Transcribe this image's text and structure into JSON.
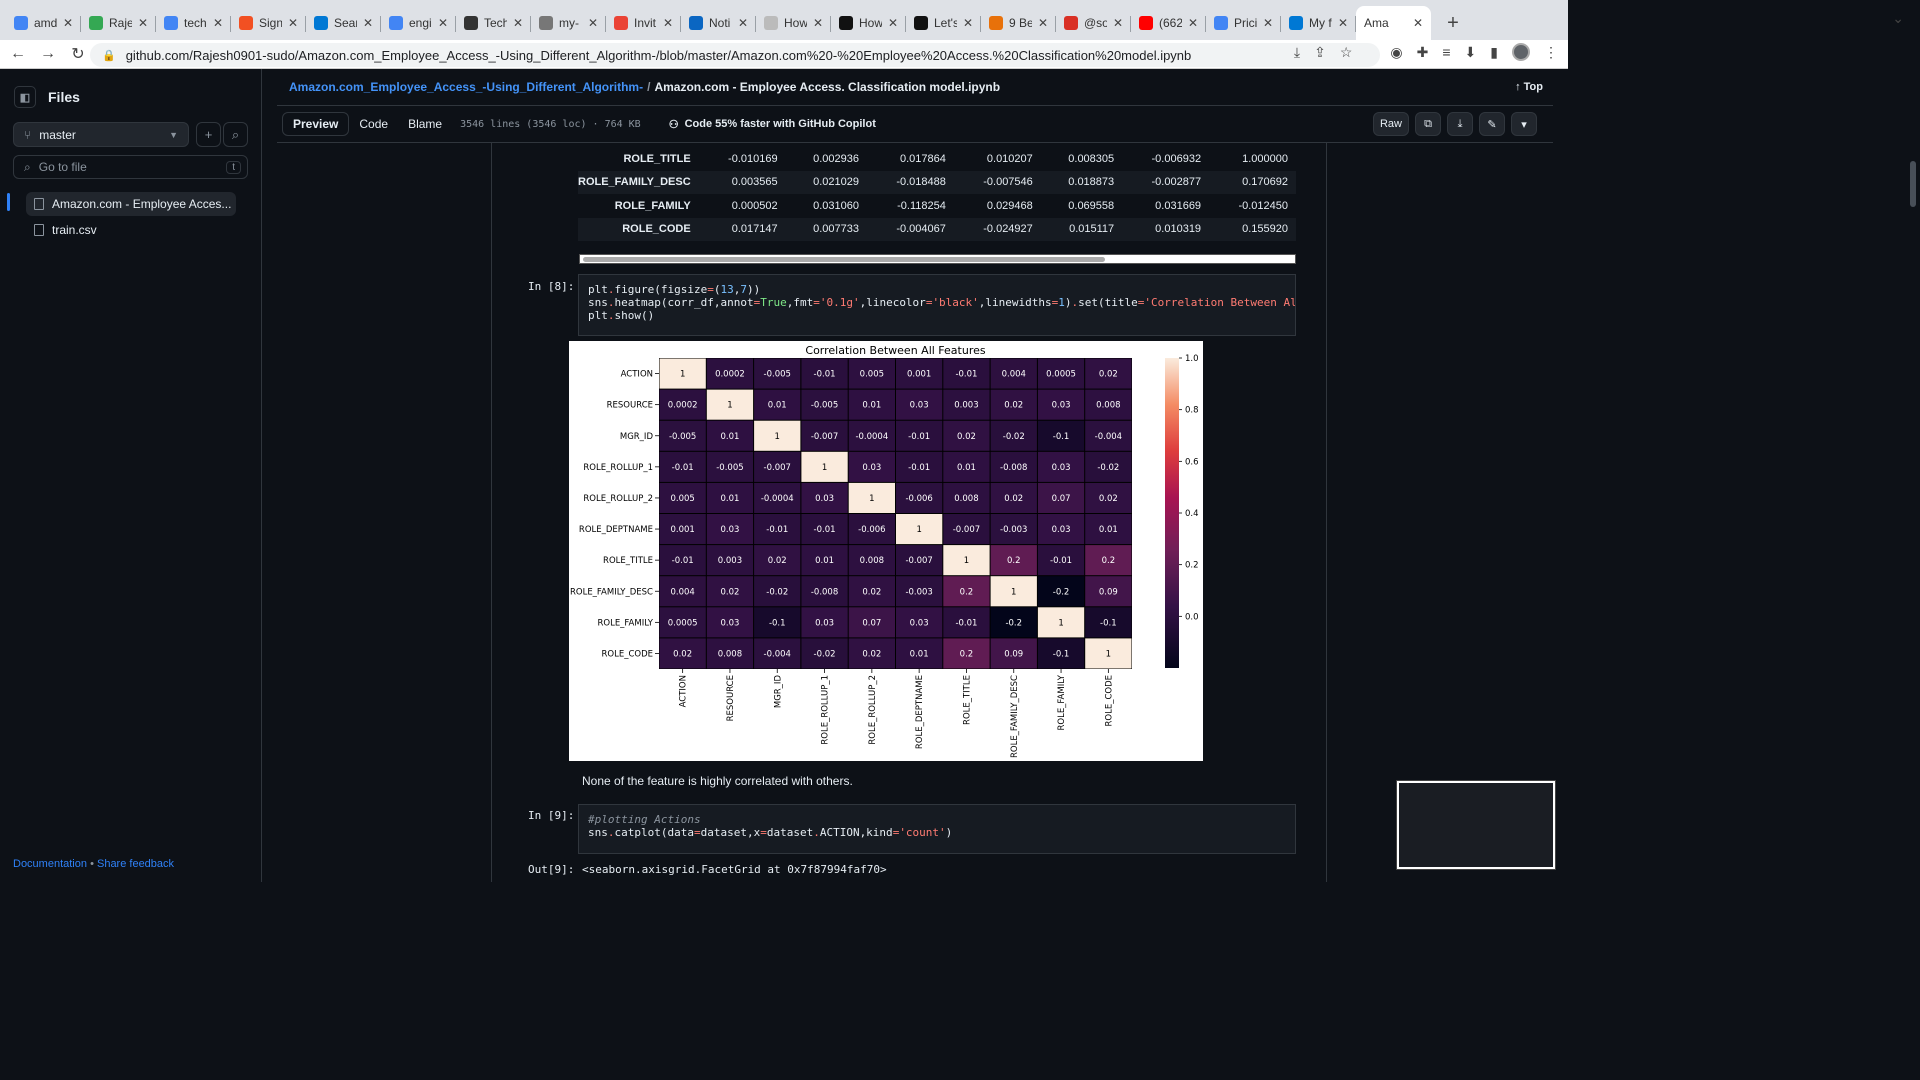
{
  "browser": {
    "tabs": [
      {
        "title": "amd",
        "icon": "google-icon",
        "color": "#4285f4"
      },
      {
        "title": "Raje",
        "icon": "link-icon",
        "color": "#34a853"
      },
      {
        "title": "tech",
        "icon": "google-icon",
        "color": "#4285f4"
      },
      {
        "title": "Sign",
        "icon": "microsoft-icon",
        "color": "#f25022"
      },
      {
        "title": "Sear",
        "icon": "cloud-icon",
        "color": "#0078d4"
      },
      {
        "title": "engi",
        "icon": "google-icon",
        "color": "#4285f4"
      },
      {
        "title": "Tech",
        "icon": "person-icon",
        "color": "#333"
      },
      {
        "title": "my-",
        "icon": "github-icon",
        "color": "#777"
      },
      {
        "title": "Invit",
        "icon": "gmail-icon",
        "color": "#ea4335"
      },
      {
        "title": "Noti",
        "icon": "linkedin-icon",
        "color": "#0a66c2"
      },
      {
        "title": "How",
        "icon": "page-icon",
        "color": "#bbb"
      },
      {
        "title": "How",
        "icon": "n-icon",
        "color": "#111"
      },
      {
        "title": "Let's",
        "icon": "medium-icon",
        "color": "#111"
      },
      {
        "title": "9 Be",
        "icon": "p-icon",
        "color": "#e8710a"
      },
      {
        "title": "@so",
        "icon": "t-icon",
        "color": "#d93025"
      },
      {
        "title": "(662",
        "icon": "youtube-icon",
        "color": "#ff0000"
      },
      {
        "title": "Prici",
        "icon": "gcloud-icon",
        "color": "#4285f4"
      },
      {
        "title": "My f",
        "icon": "cloud-icon",
        "color": "#0078d4"
      },
      {
        "title": "Ama",
        "icon": "none",
        "color": "#fff",
        "active": true
      }
    ],
    "url": "github.com/Rajesh0901-sudo/Amazon.com_Employee_Access_-Using_Different_Algorithm-/blob/master/Amazon.com%20-%20Employee%20Access.%20Classification%20model.ipynb"
  },
  "sidebar": {
    "title": "Files",
    "branch": "master",
    "goto_placeholder": "Go to file",
    "goto_kbd": "t",
    "files": [
      "Amazon.com - Employee Acces...",
      "train.csv"
    ],
    "footer": {
      "doc": "Documentation",
      "sep": "•",
      "feedback": "Share feedback"
    }
  },
  "header": {
    "repo": "Amazon.com_Employee_Access_-Using_Different_Algorithm-",
    "sep": "/",
    "file": "Amazon.com - Employee Access. Classification model.ipynb",
    "top": "Top",
    "tabs": {
      "preview": "Preview",
      "code": "Code",
      "blame": "Blame"
    },
    "info": "3546 lines (3546 loc) · 764 KB",
    "copilot": "Code 55% faster with GitHub Copilot",
    "raw": "Raw"
  },
  "table": {
    "rows": [
      {
        "label": "ROLE_TITLE",
        "cells": [
          "-0.010169",
          "0.002936",
          "0.017864",
          "0.010207",
          "0.008305",
          "-0.006932",
          "1.000000"
        ]
      },
      {
        "label": "ROLE_FAMILY_DESC",
        "cells": [
          "0.003565",
          "0.021029",
          "-0.018488",
          "-0.007546",
          "0.018873",
          "-0.002877",
          "0.170692"
        ]
      },
      {
        "label": "ROLE_FAMILY",
        "cells": [
          "0.000502",
          "0.031060",
          "-0.118254",
          "0.029468",
          "0.069558",
          "0.031669",
          "-0.012450"
        ]
      },
      {
        "label": "ROLE_CODE",
        "cells": [
          "0.017147",
          "0.007733",
          "-0.004067",
          "-0.024927",
          "0.015117",
          "0.010319",
          "0.155920"
        ]
      }
    ]
  },
  "cells": {
    "in8": "In [8]:",
    "in9": "In [9]:",
    "out9_label": "Out[9]:",
    "out9": "<seaborn.axisgrid.FacetGrid at 0x7f87994faf70>",
    "remark": "None of the feature is highly correlated with others."
  },
  "chart_data": {
    "type": "heatmap",
    "title": "Correlation Between All Features",
    "rows": [
      "ACTION",
      "RESOURCE",
      "MGR_ID",
      "ROLE_ROLLUP_1",
      "ROLE_ROLLUP_2",
      "ROLE_DEPTNAME",
      "ROLE_TITLE",
      "ROLE_FAMILY_DESC",
      "ROLE_FAMILY",
      "ROLE_CODE"
    ],
    "columns": [
      "ACTION",
      "RESOURCE",
      "MGR_ID",
      "ROLE_ROLLUP_1",
      "ROLE_ROLLUP_2",
      "ROLE_DEPTNAME",
      "ROLE_TITLE",
      "ROLE_FAMILY_DESC",
      "ROLE_FAMILY",
      "ROLE_CODE"
    ],
    "values": [
      [
        "1",
        "0.0002",
        "-0.005",
        "-0.01",
        "0.005",
        "0.001",
        "-0.01",
        "0.004",
        "0.0005",
        "0.02"
      ],
      [
        "0.0002",
        "1",
        "0.01",
        "-0.005",
        "0.01",
        "0.03",
        "0.003",
        "0.02",
        "0.03",
        "0.008"
      ],
      [
        "-0.005",
        "0.01",
        "1",
        "-0.007",
        "-0.0004",
        "-0.01",
        "0.02",
        "-0.02",
        "-0.1",
        "-0.004"
      ],
      [
        "-0.01",
        "-0.005",
        "-0.007",
        "1",
        "0.03",
        "-0.01",
        "0.01",
        "-0.008",
        "0.03",
        "-0.02"
      ],
      [
        "0.005",
        "0.01",
        "-0.0004",
        "0.03",
        "1",
        "-0.006",
        "0.008",
        "0.02",
        "0.07",
        "0.02"
      ],
      [
        "0.001",
        "0.03",
        "-0.01",
        "-0.01",
        "-0.006",
        "1",
        "-0.007",
        "-0.003",
        "0.03",
        "0.01"
      ],
      [
        "-0.01",
        "0.003",
        "0.02",
        "0.01",
        "0.008",
        "-0.007",
        "1",
        "0.2",
        "-0.01",
        "0.2"
      ],
      [
        "0.004",
        "0.02",
        "-0.02",
        "-0.008",
        "0.02",
        "-0.003",
        "0.2",
        "1",
        "-0.2",
        "0.09"
      ],
      [
        "0.0005",
        "0.03",
        "-0.1",
        "0.03",
        "0.07",
        "0.03",
        "-0.01",
        "-0.2",
        "1",
        "-0.1"
      ],
      [
        "0.02",
        "0.008",
        "-0.004",
        "-0.02",
        "0.02",
        "0.01",
        "0.2",
        "0.09",
        "-0.1",
        "1"
      ]
    ],
    "colorbar_ticks": [
      "1.0",
      "0.8",
      "0.6",
      "0.4",
      "0.2",
      "0.0"
    ],
    "vmin": -0.2,
    "vmax": 1.0
  }
}
